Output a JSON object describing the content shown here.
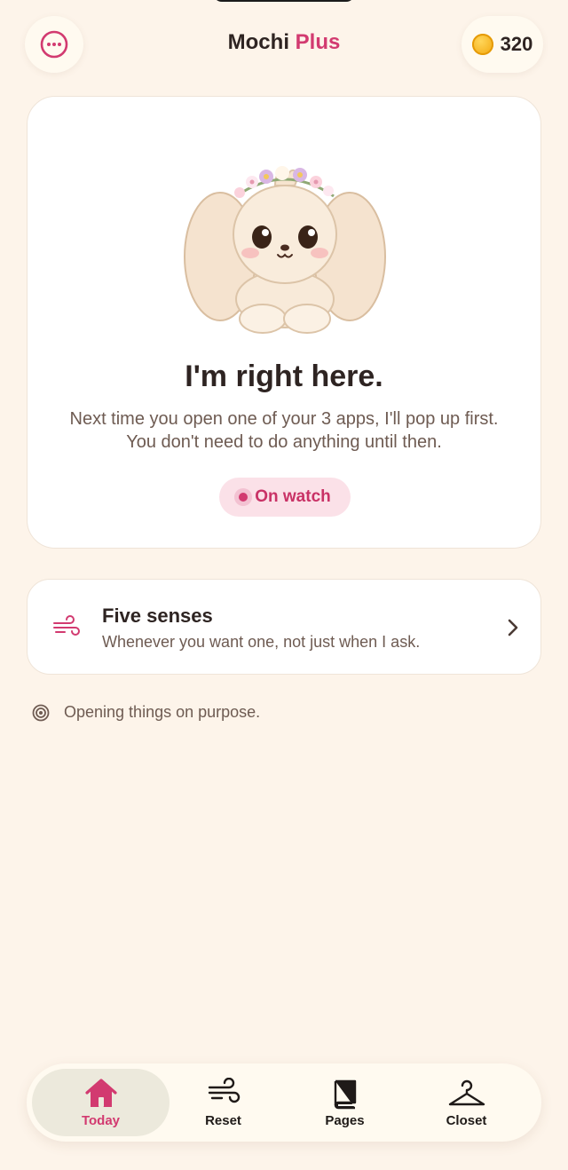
{
  "header": {
    "brand": "Mochi",
    "plus": "Plus",
    "coins": "320",
    "more_icon": "more-ellipsis-icon",
    "coin_icon": "coin-icon"
  },
  "hero": {
    "title": "I'm right here.",
    "body": "Next time you open one of your 3 apps, I'll pop up first. You don't need to do anything until then.",
    "status": "On watch"
  },
  "senses_card": {
    "title": "Five senses",
    "subtitle": "Whenever you want one, not just when I ask.",
    "icon": "wind-icon"
  },
  "intent_line": {
    "text": "Opening things on purpose.",
    "icon": "target-icon"
  },
  "tabs": [
    {
      "label": "Today",
      "icon": "home-icon",
      "active": true
    },
    {
      "label": "Reset",
      "icon": "wind-icon",
      "active": false
    },
    {
      "label": "Pages",
      "icon": "book-icon",
      "active": false
    },
    {
      "label": "Closet",
      "icon": "hanger-icon",
      "active": false
    }
  ],
  "colors": {
    "accent": "#d23a70",
    "background": "#fdf4ea",
    "card": "#ffffff",
    "pill": "#fbe1e8"
  }
}
